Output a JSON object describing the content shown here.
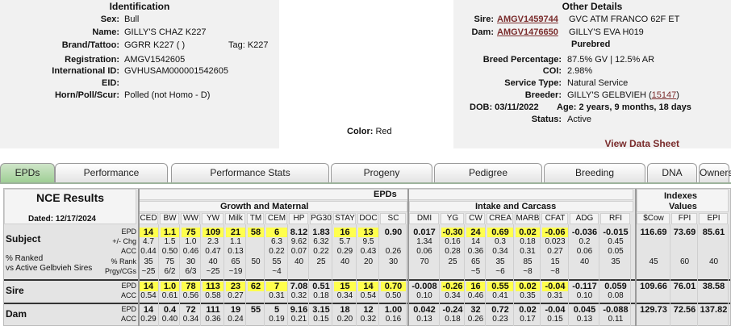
{
  "identification": {
    "title": "Identification",
    "rows": [
      {
        "label": "Sex:",
        "value": "Bull"
      },
      {
        "label": "Name:",
        "value": "GILLY'S CHAZ K227"
      },
      {
        "label": "Brand/Tattoo:",
        "value": "GGRR K227 ( )"
      },
      {
        "label": "Registration:",
        "value": "AMGV1542605"
      },
      {
        "label": "International ID:",
        "value": "GVHUSAM000001542605"
      },
      {
        "label": "EID:",
        "value": ""
      },
      {
        "label": "Horn/Poll/Scur:",
        "value": "Polled (not Homo - D)"
      }
    ],
    "tag": "Tag: K227"
  },
  "color": {
    "label": "Color:",
    "value": "Red"
  },
  "other_details": {
    "title": "Other Details",
    "sire": {
      "label": "Sire:",
      "reg": "AMGV1459744",
      "name": "GVC ATM FRANCO 62F ET"
    },
    "dam": {
      "label": "Dam:",
      "reg": "AMGV1476650",
      "name": "GILLY'S EVA H019"
    },
    "purebred": "Purebred",
    "breed_pct": {
      "label": "Breed Percentage:",
      "value": "87.5% GV | 12.5% AR"
    },
    "coi": {
      "label": "COI:",
      "value": "2.98%"
    },
    "service": {
      "label": "Service Type:",
      "value": "Natural Service"
    },
    "breeder": {
      "label": "Breeder:",
      "value": "GILLY'S GELBVIEH (",
      "link": "15147",
      "close": ")"
    },
    "dob": "DOB: 03/11/2022",
    "age": "Age: 2 years, 9 months, 18 days",
    "status": {
      "label": "Status:",
      "value": "Active"
    },
    "view_sheet": "View Data Sheet"
  },
  "tabs": [
    "EPDs",
    "Performance",
    "Performance Stats",
    "Progeny",
    "Pedigree",
    "Breeding",
    "DNA",
    "Ownership"
  ],
  "results": {
    "title": "NCE Results",
    "dated": "Dated: 12/17/2024",
    "epds_header": "EPDs",
    "growth_header": "Growth and Maternal",
    "intake_header": "Intake and Carcass",
    "indexes_header_1": "Indexes",
    "indexes_header_2": "Values",
    "columns": [
      "CED",
      "BW",
      "WW",
      "YW",
      "Milk",
      "TM",
      "CEM",
      "HP",
      "PG30",
      "STAY",
      "DOC",
      "SC",
      "DMI",
      "YG",
      "CW",
      "CREA",
      "MARB",
      "CFAT",
      "ADG",
      "RFI",
      "$Cow",
      "FPI",
      "EPI"
    ],
    "subject": {
      "label": "Subject",
      "ranked_label_1": "% Ranked",
      "ranked_label_2": "vs Active Gelbvieh Sires",
      "row_labels": [
        "EPD",
        "+/- Chg",
        "ACC",
        "% Rank",
        "Prgy/CGs"
      ],
      "epd": [
        "14",
        "1.1",
        "75",
        "109",
        "21",
        "58",
        "6",
        "8.12",
        "1.83",
        "16",
        "13",
        "0.90",
        "0.017",
        "-0.30",
        "24",
        "0.69",
        "0.02",
        "-0.06",
        "-0.036",
        "-0.015",
        "116.69",
        "73.69",
        "85.61"
      ],
      "chg": [
        "4.7",
        "1.5",
        "1.0",
        "2.3",
        "1.1",
        "",
        "6.3",
        "9.62",
        "6.32",
        "5.7",
        "9.5",
        "",
        "1.34",
        "0.16",
        "14",
        "0.3",
        "0.18",
        "0.023",
        "0.2",
        "0.45",
        "",
        "",
        ""
      ],
      "acc": [
        "0.44",
        "0.50",
        "0.46",
        "0.47",
        "0.13",
        "",
        "0.22",
        "0.07",
        "0.22",
        "0.29",
        "0.43",
        "0.26",
        "0.06",
        "0.28",
        "0.36",
        "0.34",
        "0.31",
        "0.27",
        "0.06",
        "0.05",
        "",
        "",
        ""
      ],
      "rank": [
        "35",
        "75",
        "30",
        "40",
        "65",
        "50",
        "55",
        "40",
        "25",
        "40",
        "20",
        "30",
        "70",
        "25",
        "65",
        "35",
        "85",
        "15",
        "40",
        "35",
        "45",
        "60",
        "40"
      ],
      "prgy": [
        "~25",
        "6/2",
        "6/3",
        "~25",
        "~19",
        "",
        "~4",
        "",
        "",
        "",
        "",
        "",
        "",
        "",
        "~5",
        "~6",
        "~8",
        "~8",
        "",
        "",
        "",
        "",
        ""
      ],
      "epd_hl": [
        true,
        true,
        true,
        true,
        true,
        true,
        true,
        false,
        false,
        true,
        true,
        false,
        false,
        true,
        true,
        true,
        true,
        true,
        false,
        false,
        false,
        false,
        false
      ]
    },
    "sire": {
      "label": "Sire",
      "row_labels": [
        "EPD",
        "ACC"
      ],
      "epd": [
        "14",
        "1.0",
        "78",
        "113",
        "23",
        "62",
        "7",
        "7.08",
        "0.51",
        "15",
        "14",
        "0.70",
        "-0.008",
        "-0.26",
        "16",
        "0.55",
        "0.02",
        "-0.04",
        "-0.117",
        "0.059",
        "109.66",
        "76.01",
        "38.58"
      ],
      "acc": [
        "0.54",
        "0.61",
        "0.56",
        "0.58",
        "0.27",
        "",
        "0.31",
        "0.32",
        "0.18",
        "0.34",
        "0.54",
        "0.50",
        "0.10",
        "0.34",
        "0.46",
        "0.41",
        "0.35",
        "0.31",
        "0.10",
        "0.08",
        "",
        "",
        ""
      ],
      "epd_hl": [
        true,
        true,
        true,
        true,
        true,
        true,
        true,
        false,
        false,
        true,
        true,
        true,
        false,
        true,
        true,
        true,
        true,
        true,
        false,
        false,
        false,
        false,
        false
      ]
    },
    "dam": {
      "label": "Dam",
      "row_labels": [
        "EPD",
        "ACC"
      ],
      "epd": [
        "14",
        "0.4",
        "72",
        "111",
        "19",
        "55",
        "5",
        "9.16",
        "3.15",
        "18",
        "12",
        "1.00",
        "0.042",
        "-0.24",
        "32",
        "0.72",
        "0.02",
        "-0.04",
        "0.045",
        "-0.088",
        "129.73",
        "72.56",
        "137.82"
      ],
      "acc": [
        "0.29",
        "0.40",
        "0.34",
        "0.36",
        "0.24",
        "",
        "0.19",
        "0.21",
        "0.15",
        "0.20",
        "0.32",
        "0.16",
        "0.13",
        "0.18",
        "0.26",
        "0.23",
        "0.17",
        "0.15",
        "0.13",
        "0.11",
        "",
        "",
        ""
      ]
    }
  },
  "colors": {
    "highlight": "#ffff4d",
    "link": "#7a2c2c",
    "active_tab": "#9fcf95"
  }
}
